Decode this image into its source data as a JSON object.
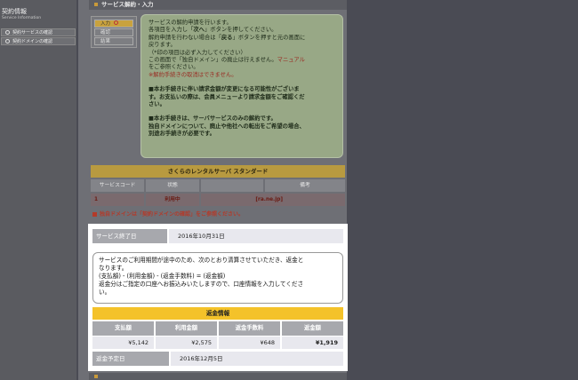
{
  "sidebar": {
    "title": "契約情報",
    "subtitle": "Service Information",
    "items": [
      {
        "label": "契約サービスの確認"
      },
      {
        "label": "契約ドメインの確認"
      }
    ]
  },
  "page_title": "サービス解約・入力",
  "steps": [
    "入力",
    "確認",
    "結果"
  ],
  "notice": {
    "l1": "サービスの解約申請を行います。",
    "l2_a": "各項目を入力し「",
    "l2_b": "次へ",
    "l2_c": "」ボタンを押してください。",
    "l3_a": "解約申請を行わない場合は「",
    "l3_b": "戻る",
    "l3_c": "」ボタンを押すと元の画面に",
    "l4": "戻ります。",
    "l5": "（*印の項目は必ず入力してください）",
    "l6_a": "この画面で「独自ドメイン」の廃止は行えません。",
    "l6_b": "マニュアル",
    "l7": "をご参照ください。",
    "l8": "※解約手続きの取消はできません。",
    "l9": "■本お手続きに伴い請求金額が変更になる可能性がございま",
    "l10": "す。お支払いの際は、会員メニューより請求金額をご確認くだ",
    "l11": "さい。",
    "l12": "■本お手続きは、サーバサービスのみの解約です。",
    "l13": "独自ドメインについて、廃止や他社への転出をご希望の場合、",
    "l14": "別途お手続きが必要です。"
  },
  "plan": {
    "name": "さくらのレンタルサーバ スタンダード",
    "headers": [
      "サービスコード",
      "状態",
      "",
      "備考"
    ],
    "row": {
      "code": "1",
      "status": "利用中",
      "domain": "[ra.ne.jp]"
    },
    "note": "独自ドメインは「契約ドメインの確認」をご参照ください。"
  },
  "end": {
    "label": "サービス終了日",
    "value": "2016年10月31日"
  },
  "info": {
    "l1": "サービスのご利用期間が途中のため、次のとおり清算させていただき、返金と",
    "l2": "なります。",
    "l3": "(支払額) - (利用金額) - (返金手数料) = (返金額)",
    "l4": "返金分はご指定の口座へお振込みいたしますので、口座情報を入力してくださ",
    "l5": "い。"
  },
  "refund": {
    "title": "返金情報",
    "headers": [
      "支払額",
      "利用金額",
      "返金手数料",
      "返金額"
    ],
    "values": [
      "¥5,142",
      "¥2,575",
      "¥648",
      "¥1,919"
    ]
  },
  "scheduled": {
    "label": "返金予定日",
    "value": "2016年12月5日"
  }
}
